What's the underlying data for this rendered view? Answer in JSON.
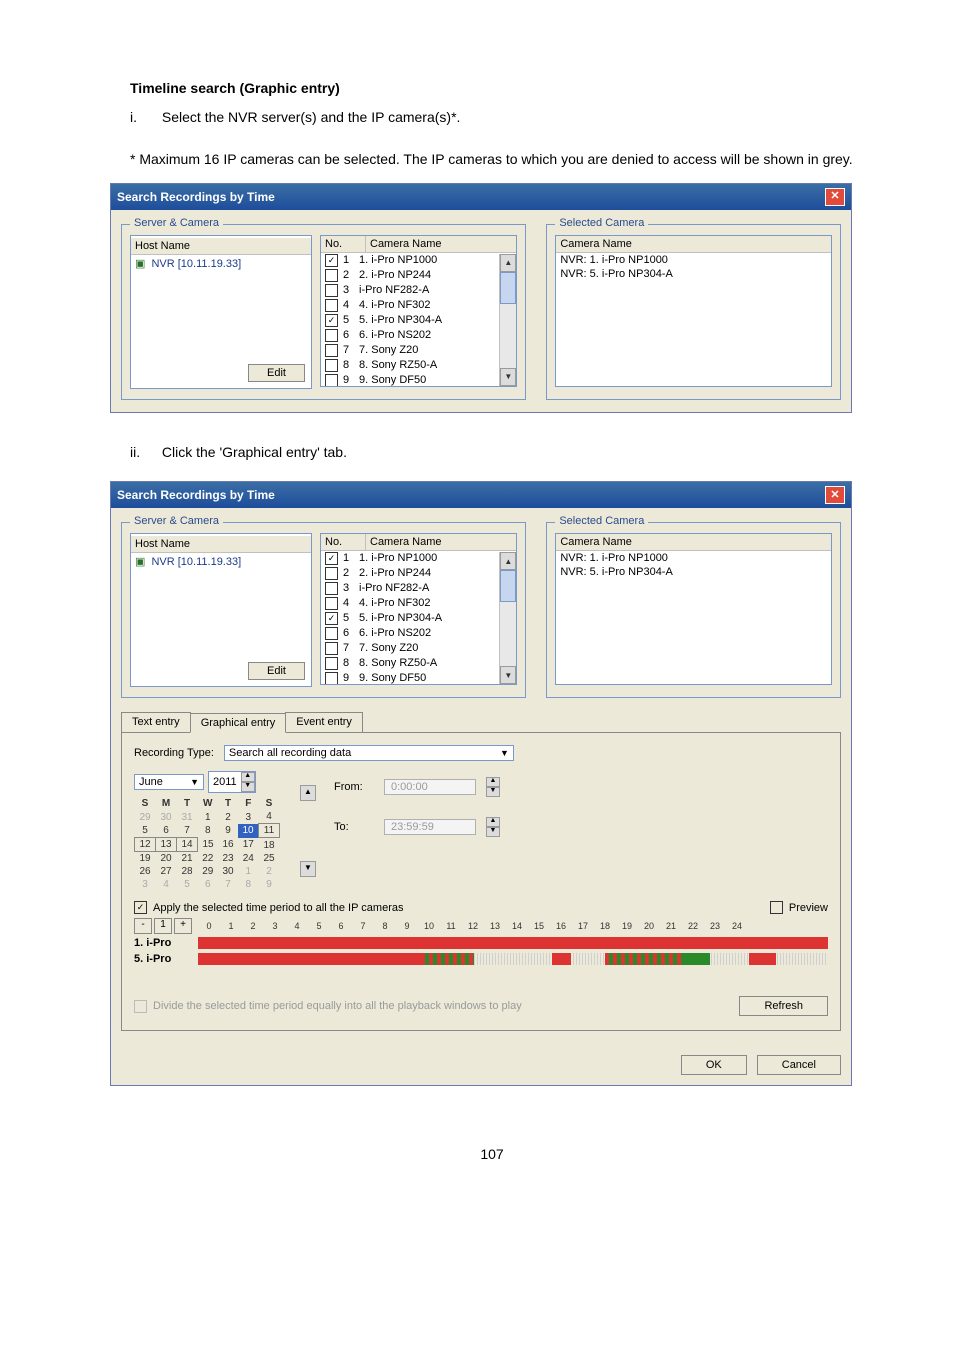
{
  "heading": "Timeline search (Graphic entry)",
  "step1": {
    "roman": "i.",
    "text": "Select the NVR server(s) and the IP camera(s)*."
  },
  "note": "* Maximum 16 IP cameras can be selected.   The IP cameras to which you are denied to access will be shown in grey.",
  "step2": {
    "roman": "ii.",
    "text": "Click the 'Graphical entry' tab."
  },
  "win": {
    "title": "Search Recordings by Time",
    "group_sc": "Server & Camera",
    "group_sel": "Selected Camera",
    "host_header": "Host Name",
    "host_row": "NVR [10.11.19.33]",
    "edit": "Edit",
    "no_header": "No.",
    "cam_header": "Camera Name",
    "cams": [
      {
        "no": "1",
        "name": "1. i-Pro NP1000",
        "checked": true
      },
      {
        "no": "2",
        "name": "2. i-Pro NP244",
        "checked": false
      },
      {
        "no": "3",
        "name": "i-Pro NF282-A",
        "checked": false
      },
      {
        "no": "4",
        "name": "4. i-Pro NF302",
        "checked": false
      },
      {
        "no": "5",
        "name": "5. i-Pro NP304-A",
        "checked": true
      },
      {
        "no": "6",
        "name": "6. i-Pro NS202",
        "checked": false
      },
      {
        "no": "7",
        "name": "7. Sony Z20",
        "checked": false
      },
      {
        "no": "8",
        "name": "8. Sony RZ50-A",
        "checked": false
      },
      {
        "no": "9",
        "name": "9. Sony DF50",
        "checked": false
      }
    ],
    "sel_header": "Camera Name",
    "selected": [
      "NVR: 1. i-Pro NP1000",
      "NVR: 5. i-Pro NP304-A"
    ]
  },
  "tabs": {
    "text": "Text entry",
    "graph": "Graphical entry",
    "event": "Event entry"
  },
  "rec_type_label": "Recording Type:",
  "rec_type_value": "Search all recording data",
  "month": "June",
  "year": "2011",
  "dow": [
    "S",
    "M",
    "T",
    "W",
    "T",
    "F",
    "S"
  ],
  "from_label": "From:",
  "to_label": "To:",
  "from_val": "0:00:00",
  "to_val": "23:59:59",
  "apply_label": "Apply the selected time period to all the IP cameras",
  "preview_label": "Preview",
  "hours": [
    "0",
    "1",
    "2",
    "3",
    "4",
    "5",
    "6",
    "7",
    "8",
    "9",
    "10",
    "11",
    "12",
    "13",
    "14",
    "15",
    "16",
    "17",
    "18",
    "19",
    "20",
    "21",
    "22",
    "23",
    "24"
  ],
  "tl_rows": [
    "1. i-Pro",
    "5. i-Pro"
  ],
  "divide_label": "Divide the selected time period equally into all the playback windows to play",
  "refresh": "Refresh",
  "ok": "OK",
  "cancel": "Cancel",
  "pagenum": "107",
  "cal": [
    [
      {
        "d": "29",
        "c": "dim"
      },
      {
        "d": "30",
        "c": "dim"
      },
      {
        "d": "31",
        "c": "dim"
      },
      {
        "d": "1"
      },
      {
        "d": "2"
      },
      {
        "d": "3"
      },
      {
        "d": "4"
      }
    ],
    [
      {
        "d": "5"
      },
      {
        "d": "6"
      },
      {
        "d": "7"
      },
      {
        "d": "8"
      },
      {
        "d": "9"
      },
      {
        "d": "10",
        "c": "hi"
      },
      {
        "d": "11",
        "c": "box"
      }
    ],
    [
      {
        "d": "12",
        "c": "box"
      },
      {
        "d": "13",
        "c": "box"
      },
      {
        "d": "14",
        "c": "box"
      },
      {
        "d": "15"
      },
      {
        "d": "16"
      },
      {
        "d": "17"
      },
      {
        "d": "18"
      }
    ],
    [
      {
        "d": "19"
      },
      {
        "d": "20"
      },
      {
        "d": "21"
      },
      {
        "d": "22"
      },
      {
        "d": "23"
      },
      {
        "d": "24"
      },
      {
        "d": "25"
      }
    ],
    [
      {
        "d": "26"
      },
      {
        "d": "27"
      },
      {
        "d": "28"
      },
      {
        "d": "29"
      },
      {
        "d": "30"
      },
      {
        "d": "1",
        "c": "dim"
      },
      {
        "d": "2",
        "c": "dim"
      }
    ],
    [
      {
        "d": "3",
        "c": "dim"
      },
      {
        "d": "4",
        "c": "dim"
      },
      {
        "d": "5",
        "c": "dim"
      },
      {
        "d": "6",
        "c": "dim"
      },
      {
        "d": "7",
        "c": "dim"
      },
      {
        "d": "8",
        "c": "dim"
      },
      {
        "d": "9",
        "c": "dim"
      }
    ]
  ],
  "chart_data": {
    "type": "timeline",
    "title": "Recording timeline (hours 0–24)",
    "x": [
      0,
      1,
      2,
      3,
      4,
      5,
      6,
      7,
      8,
      9,
      10,
      11,
      12,
      13,
      14,
      15,
      16,
      17,
      18,
      19,
      20,
      21,
      22,
      23,
      24
    ],
    "series": [
      {
        "name": "1. i-Pro",
        "segments": [
          {
            "start": 0,
            "end": 24,
            "state": "red"
          }
        ]
      },
      {
        "name": "5. i-Pro",
        "segments": [
          {
            "start": 0,
            "end": 8.5,
            "state": "red"
          },
          {
            "start": 8.5,
            "end": 10.5,
            "state": "mixed"
          },
          {
            "start": 10.5,
            "end": 13.5,
            "state": "none"
          },
          {
            "start": 13.5,
            "end": 14.2,
            "state": "red"
          },
          {
            "start": 14.2,
            "end": 15.5,
            "state": "none"
          },
          {
            "start": 15.5,
            "end": 18.5,
            "state": "mixed"
          },
          {
            "start": 18.5,
            "end": 19.5,
            "state": "green"
          },
          {
            "start": 19.5,
            "end": 21,
            "state": "none"
          },
          {
            "start": 21,
            "end": 22,
            "state": "red"
          },
          {
            "start": 22,
            "end": 24,
            "state": "none"
          }
        ]
      }
    ]
  }
}
